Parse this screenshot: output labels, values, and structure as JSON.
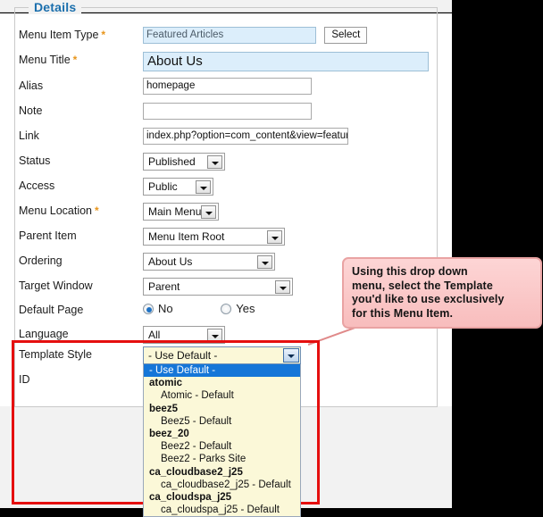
{
  "panel": {
    "legend": "Details"
  },
  "fields": {
    "menu_item_type": {
      "label": "Menu Item Type",
      "required": true,
      "value": "Featured Articles",
      "select_button": "Select"
    },
    "menu_title": {
      "label": "Menu Title",
      "required": true,
      "value": "About Us"
    },
    "alias": {
      "label": "Alias",
      "required": false,
      "value": "homepage"
    },
    "note": {
      "label": "Note",
      "required": false,
      "value": ""
    },
    "link": {
      "label": "Link",
      "required": false,
      "value": "index.php?option=com_content&view=featured"
    },
    "status": {
      "label": "Status",
      "required": false,
      "value": "Published"
    },
    "access": {
      "label": "Access",
      "required": false,
      "value": "Public"
    },
    "menu_location": {
      "label": "Menu Location",
      "required": true,
      "value": "Main Menu"
    },
    "parent_item": {
      "label": "Parent Item",
      "required": false,
      "value": "Menu Item Root"
    },
    "ordering": {
      "label": "Ordering",
      "required": false,
      "value": "About Us"
    },
    "target_window": {
      "label": "Target Window",
      "required": false,
      "value": "Parent"
    },
    "default_page": {
      "label": "Default Page",
      "required": false,
      "no_label": "No",
      "yes_label": "Yes",
      "selected": "No"
    },
    "language": {
      "label": "Language",
      "required": false,
      "value": "All"
    },
    "template_style": {
      "label": "Template Style",
      "required": false,
      "value": "- Use Default -"
    },
    "id": {
      "label": "ID",
      "required": false,
      "value": ""
    }
  },
  "template_style_options": [
    {
      "text": "- Use Default -",
      "type": "option",
      "selected": true
    },
    {
      "text": "atomic",
      "type": "group"
    },
    {
      "text": "Atomic - Default",
      "type": "option"
    },
    {
      "text": "beez5",
      "type": "group"
    },
    {
      "text": "Beez5 - Default",
      "type": "option"
    },
    {
      "text": "beez_20",
      "type": "group"
    },
    {
      "text": "Beez2 - Default",
      "type": "option"
    },
    {
      "text": "Beez2 - Parks Site",
      "type": "option"
    },
    {
      "text": "ca_cloudbase2_j25",
      "type": "group"
    },
    {
      "text": "ca_cloudbase2_j25 - Default",
      "type": "option"
    },
    {
      "text": "ca_cloudspa_j25",
      "type": "group"
    },
    {
      "text": "ca_cloudspa_j25 - Default",
      "type": "option"
    }
  ],
  "callout": {
    "line1": "Using this drop down",
    "line2": "menu, select the Template",
    "line3": "you'd like to use exclusively",
    "line4": "for this Menu Item."
  },
  "colors": {
    "legend_blue": "#1b6fad",
    "required_orange": "#e8951b",
    "highlight_red": "#e50f0f",
    "callout_pink": "#fdd5d5",
    "selected_blue": "#1576d8",
    "readonly_blue": "#dceefb",
    "dropdown_cream": "#fbf8d8"
  }
}
